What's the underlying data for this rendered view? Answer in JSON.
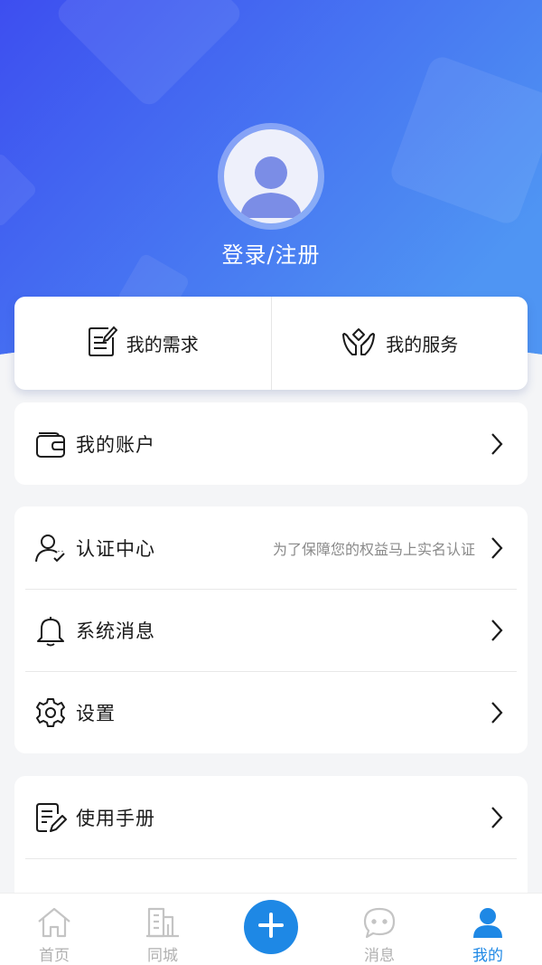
{
  "header": {
    "login_label": "登录/注册",
    "gradient_start": "#3f51f0",
    "gradient_end": "#4a8ff2"
  },
  "quick_actions": [
    {
      "label": "我的需求",
      "icon": "document-edit-icon"
    },
    {
      "label": "我的服务",
      "icon": "hands-service-icon"
    }
  ],
  "account_card": {
    "items": [
      {
        "label": "我的账户",
        "icon": "wallet-icon"
      }
    ]
  },
  "settings_card": {
    "items": [
      {
        "label": "认证中心",
        "hint": "为了保障您的权益马上实名认证",
        "icon": "user-verify-icon"
      },
      {
        "label": "系统消息",
        "icon": "bell-icon"
      },
      {
        "label": "设置",
        "icon": "gear-icon"
      }
    ]
  },
  "manual_card": {
    "items": [
      {
        "label": "使用手册",
        "icon": "manual-icon"
      }
    ]
  },
  "tabbar": {
    "tabs": [
      {
        "label": "首页",
        "icon": "home-icon"
      },
      {
        "label": "同城",
        "icon": "buildings-icon"
      },
      {
        "label": "",
        "icon": "plus-icon"
      },
      {
        "label": "消息",
        "icon": "chat-icon"
      },
      {
        "label": "我的",
        "icon": "user-icon"
      }
    ],
    "active_color": "#1e88e5",
    "inactive_color": "#b0b0b0"
  }
}
